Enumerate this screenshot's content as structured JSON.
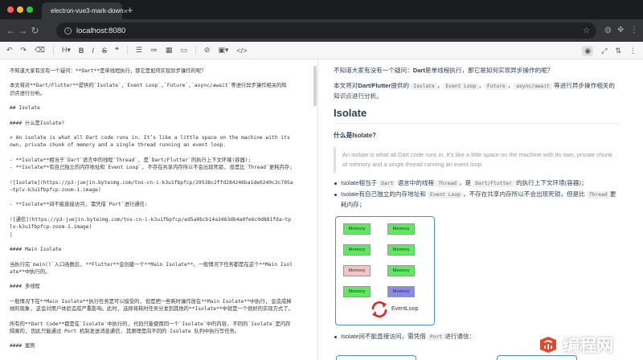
{
  "browser": {
    "tab_title": "electron-vue3-mark-down",
    "tab_close": "×",
    "new_tab": "+",
    "url": "localhost:8080"
  },
  "icons": {
    "toolbar": [
      "undo-icon",
      "redo-icon",
      "clear-icon",
      "heading-icon",
      "bold-icon",
      "italic-icon",
      "strikethrough-icon",
      "quote-icon",
      "unordered-list-icon",
      "ordered-list-icon",
      "table-icon",
      "hr-icon",
      "link-icon",
      "image-icon",
      "code-icon",
      "preview-icon",
      "fullscreen-icon",
      "sync-scroll-icon",
      "toc-icon"
    ]
  },
  "editor": {
    "lines": [
      {
        "text": "不知道大家有没有一个疑问：**Dart**是单线程执行，那它是如何实现异步操作的呢？",
        "gap": false
      },
      {
        "text": "本文将对**Dart/Flutter**提供的`Isolate`,`Event Loop`,`Future`,`async/await`等进行异步操作相关的知",
        "gap": true
      },
      {
        "text": "识点进行分析。",
        "gap": false
      },
      {
        "text": "## Isolate",
        "gap": true
      },
      {
        "text": "#### 什么是Isolate?",
        "gap": true
      },
      {
        "text": "> An isolate is what all Dart code runs in. It’s like a little space on the machine with its",
        "gap": true
      },
      {
        "text": "own, private chunk of memory and a single thread running an event loop.",
        "gap": false
      },
      {
        "text": "- **Isolate**相当于`Dart`语言中的线程`Thread`, 是`Dart/Flutter`的执行上下文环境(容器);",
        "gap": true
      },
      {
        "text": "- **Isolate**有自己独立的内存地址和`Event Loop`, 不存在共享内存所以不会出现死锁, 但是比`Thread`更耗内存;",
        "gap": false
      },
      {
        "text": "![Isolate](https://p3-juejin.byteimg.com/tos-cn-i-k3u1fbpfcp/29538c2ffd284246ba1de0240c3c705a",
        "gap": true
      },
      {
        "text": "~tplv-k3u1fbpfcp-zoom-1.image)",
        "gap": false
      },
      {
        "text": "- **Isolate**间不能直接访问, 需凭借`Port`进行通信:",
        "gap": true
      },
      {
        "text": "![通信](https://p3-juejin.byteimg.com/tos-cn-i-k3u1fbpfcp/ed5a0bcb14a3463db4a0fe6c0d881fda~tp",
        "gap": true
      },
      {
        "text": "lv-k3u1fbpfcp-zoom-1.image)",
        "gap": false
      },
      {
        "text": "|",
        "gap": false
      },
      {
        "text": "#### Main Isolate",
        "gap": true
      },
      {
        "text": "当执行完`main()`入口函数后, **Flutter**会创建一个**Main Isolate**。一般情况下任务都是在这个**Main Isol",
        "gap": true
      },
      {
        "text": "ate**中执行的。",
        "gap": false
      },
      {
        "text": "#### 多线程",
        "gap": true
      },
      {
        "text": "一般情况下在**Main Isolate**执行任务是可以接受的, 但是把一些耗时操作放在**Main Isolate**中执行, 会造成掉",
        "gap": true
      },
      {
        "text": "帧的现象, 这会对用户体验造成严重影响。此时, 选择将耗时任务分发到其他的**Isolate**中就是一个很好的实现方式了。",
        "gap": false
      },
      {
        "text": "所有的**Dart Code**都是在`Isolate`中执行的, 代码只能使用同一个`Isolate`中的内容, 不同的`Isolate`是内存",
        "gap": true
      },
      {
        "text": "隔离的, 因此只能通过 Port 机制发送消息通信, 其原理是向不同的 Isolate 队列中执行写任务。",
        "gap": false
      },
      {
        "text": "#### 案例",
        "gap": true
      }
    ]
  },
  "preview": {
    "p1": {
      "a": "不知道大家有没有一个疑问：",
      "b": "Dart",
      "c": "是单线程执行，那它是如何实现异步操作的呢？"
    },
    "p2": {
      "a": "本文将对",
      "b": "Dart/Flutter",
      "c": "提供的",
      "code1": "Isolate",
      "code2": "Event Loop",
      "code3": "Future",
      "code4": "async/await",
      "d": "等进行异步操作相关的知识点进行分析。",
      "comma": "，"
    },
    "h2": "Isolate",
    "h4": "什么是Isolate?",
    "quote": "An isolate is what all Dart code runs in. It’s like a little space on the machine with its own, private chunk of memory and a single thread running an event loop.",
    "li1": {
      "a": "Isolate",
      "b": "相当于",
      "code1": "Dart",
      "c": "语言中的线程",
      "code2": "Thread",
      "d": "，是",
      "code3": "Dart/Flutter",
      "e": "的执行上下文环境(容器)；"
    },
    "li2": {
      "a": "Isolate",
      "b": "有自己独立的内存地址和",
      "code1": "Event Loop",
      "c": "，不存在共享内存所以不会出现死锁，但是比",
      "code2": "Thread",
      "d": "更耗内存；"
    },
    "diagram": {
      "cells": [
        {
          "label": "Memory",
          "color": "#61e861"
        },
        {
          "label": "Memory",
          "color": "#61e861"
        },
        {
          "label": "Memory",
          "color": "#61e861"
        },
        {
          "label": "Memory",
          "color": "#61e861"
        },
        {
          "label": "Memory",
          "color": "#f2c4c4"
        },
        {
          "label": "Memory",
          "color": "#61e861"
        },
        {
          "label": "Memory",
          "color": "#61e861"
        },
        {
          "label": "Memory",
          "color": "#8a8ae8"
        }
      ],
      "event_loop_label": "EventLoop",
      "event_loop_color": "#e02828"
    },
    "li3": {
      "a": "Isolate",
      "b": "间不能直接访问，需凭借",
      "code1": "Port",
      "c": "进行通信："
    }
  },
  "watermark": {
    "text": "编程网"
  }
}
